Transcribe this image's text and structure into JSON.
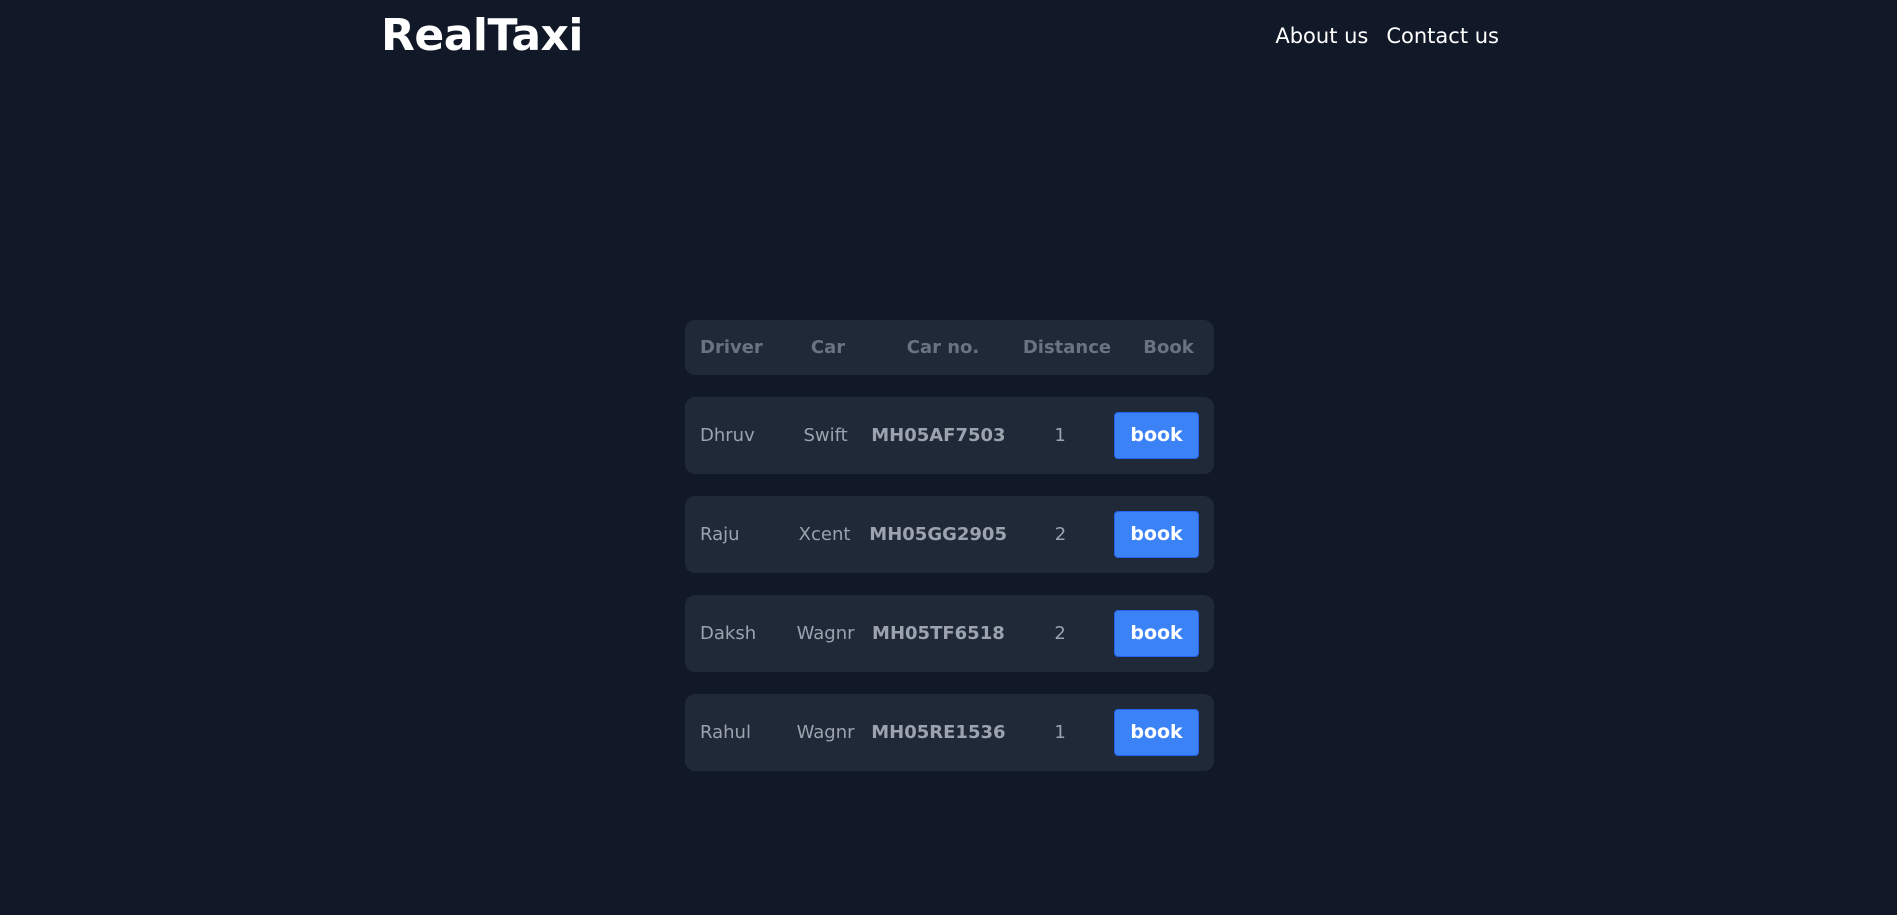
{
  "header": {
    "brand": "RealTaxi",
    "nav": [
      {
        "label": "About us"
      },
      {
        "label": "Contact us"
      }
    ]
  },
  "table": {
    "columns": [
      "Driver",
      "Car",
      "Car no.",
      "Distance",
      "Book"
    ],
    "rows": [
      {
        "driver": "Dhruv",
        "car": "Swift",
        "car_no": "MH05AF7503",
        "distance": "1",
        "book_label": "book"
      },
      {
        "driver": "Raju",
        "car": "Xcent",
        "car_no": "MH05GG2905",
        "distance": "2",
        "book_label": "book"
      },
      {
        "driver": "Daksh",
        "car": "Wagnr",
        "car_no": "MH05TF6518",
        "distance": "2",
        "book_label": "book"
      },
      {
        "driver": "Rahul",
        "car": "Wagnr",
        "car_no": "MH05RE1536",
        "distance": "1",
        "book_label": "book"
      }
    ]
  },
  "colors": {
    "background": "#111827",
    "row_background": "#1f2937",
    "accent": "#3b82f6"
  }
}
